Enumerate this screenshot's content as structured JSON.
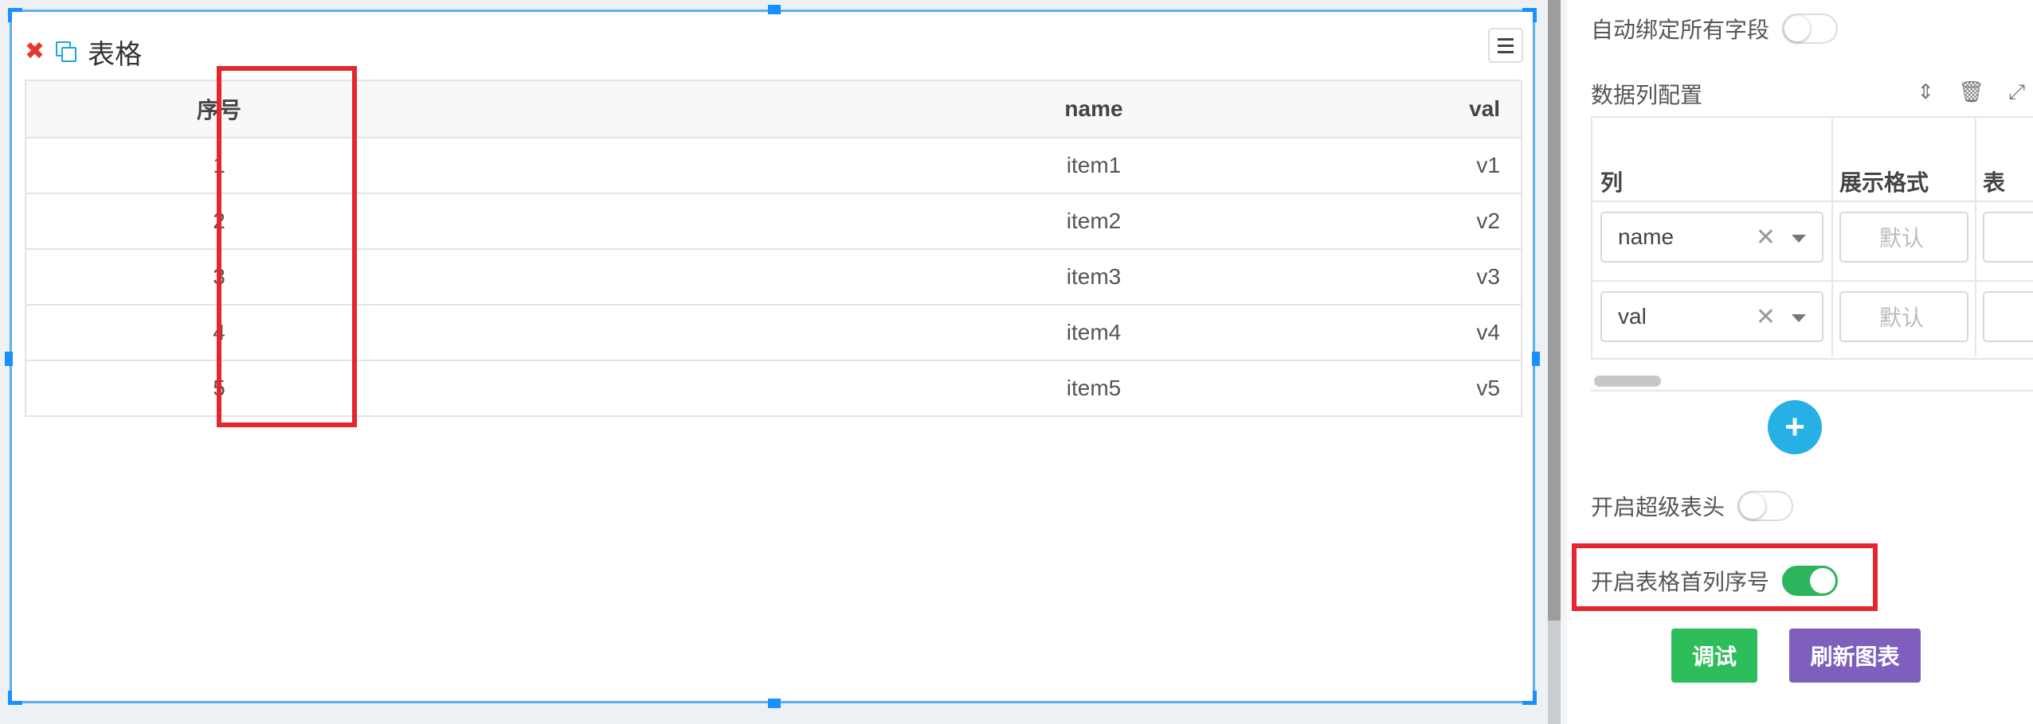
{
  "widget": {
    "title": "表格",
    "close_icon": "✖",
    "table": {
      "columns": [
        "序号",
        "name",
        "val"
      ],
      "rows": [
        {
          "idx": "1",
          "name": "item1",
          "val": "v1"
        },
        {
          "idx": "2",
          "name": "item2",
          "val": "v2"
        },
        {
          "idx": "3",
          "name": "item3",
          "val": "v3"
        },
        {
          "idx": "4",
          "name": "item4",
          "val": "v4"
        },
        {
          "idx": "5",
          "name": "item5",
          "val": "v5"
        }
      ]
    }
  },
  "panel": {
    "auto_bind_label": "自动绑定所有字段",
    "auto_bind_on": false,
    "columns_config_label": "数据列配置",
    "grid_headers": [
      "列",
      "展示格式",
      "表"
    ],
    "grid_rows": [
      {
        "field": "name",
        "format_placeholder": "默认"
      },
      {
        "field": "val",
        "format_placeholder": "默认"
      }
    ],
    "add_symbol": "+",
    "super_header_label": "开启超级表头",
    "super_header_on": false,
    "first_col_index_label": "开启表格首列序号",
    "first_col_index_on": true,
    "debug_label": "调试",
    "refresh_label": "刷新图表"
  },
  "colors": {
    "highlight": "#e5262f",
    "selection": "#1890ff",
    "toggle_on": "#2db55d",
    "debug_btn": "#2dbd5a",
    "refresh_btn": "#7f5fbe",
    "add_btn": "#26b0e6"
  }
}
